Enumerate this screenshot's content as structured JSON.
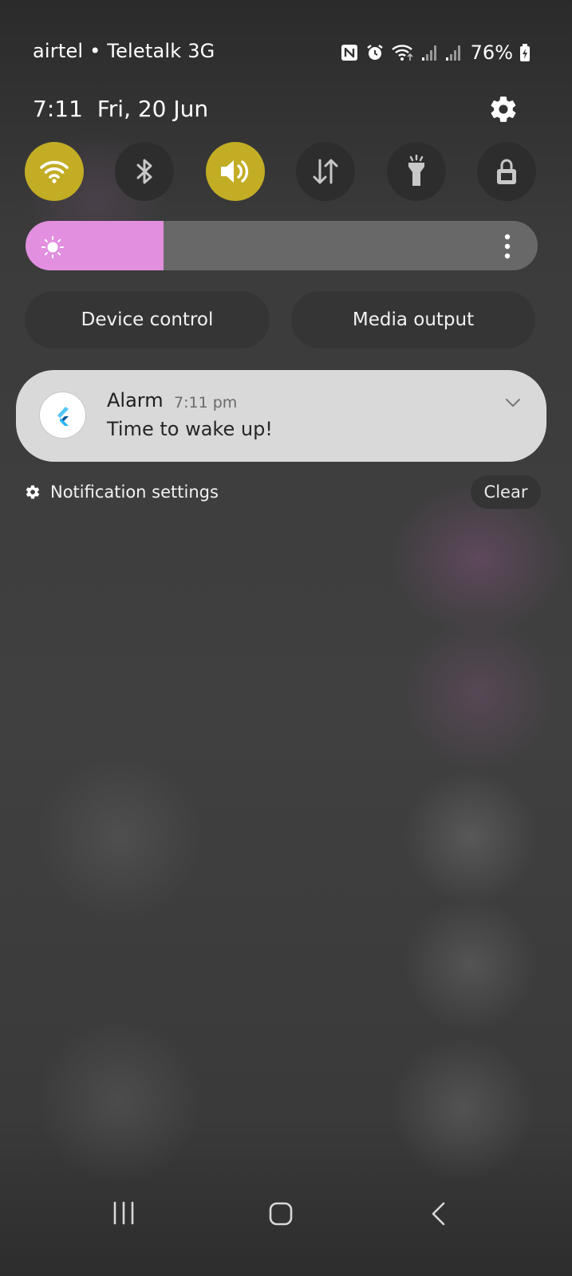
{
  "status_bar": {
    "carrier": "airtel • Teletalk 3G",
    "battery": "76%",
    "icons": [
      "nfc-icon",
      "alarm-icon",
      "wifi-signal-icon",
      "cell-signal-icon",
      "cell-signal-icon",
      "battery-charging-icon"
    ]
  },
  "header": {
    "time": "7:11",
    "date": "Fri, 20 Jun",
    "settings_icon": "gear-icon"
  },
  "quick_toggles": [
    {
      "name": "Wi-Fi",
      "icon": "wifi-icon",
      "on": true
    },
    {
      "name": "Bluetooth",
      "icon": "bluetooth-icon",
      "on": false
    },
    {
      "name": "Sound",
      "icon": "speaker-icon",
      "on": true
    },
    {
      "name": "Mobile data",
      "icon": "data-arrows-icon",
      "on": false
    },
    {
      "name": "Torch",
      "icon": "flashlight-icon",
      "on": false
    },
    {
      "name": "Lock",
      "icon": "lock-icon",
      "on": false
    }
  ],
  "brightness": {
    "level": 0.27,
    "color": "#e28fe0"
  },
  "buttons": {
    "device_control": "Device control",
    "media_output": "Media output"
  },
  "notification": {
    "app": "Alarm",
    "time": "7:11 pm",
    "text": "Time to wake up!"
  },
  "notification_footer": {
    "settings_label": "Notification settings",
    "clear_label": "Clear"
  },
  "colors": {
    "toggle_on": "#c2ad25",
    "toggle_off": "#2d2d2d",
    "card": "#d9d9d9"
  }
}
